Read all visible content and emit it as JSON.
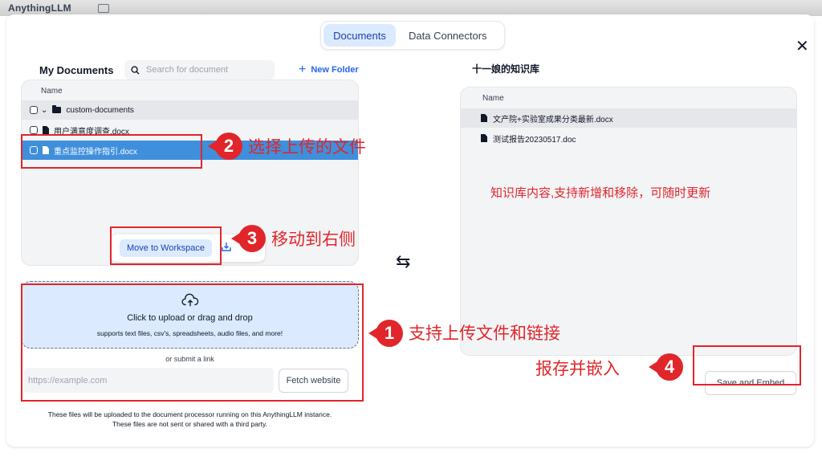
{
  "app": {
    "title": "AnythingLLM"
  },
  "tabs": [
    {
      "label": "Documents",
      "active": true
    },
    {
      "label": "Data Connectors",
      "active": false
    }
  ],
  "my_documents": {
    "title": "My Documents",
    "search_placeholder": "Search for document",
    "new_folder_label": "New Folder",
    "column_header": "Name",
    "items": [
      {
        "type": "folder",
        "name": "custom-documents",
        "selected": false
      },
      {
        "type": "file",
        "name": "用户满意度调查.docx",
        "selected": false
      },
      {
        "type": "file",
        "name": "重点监控操作指引.docx",
        "selected": true
      }
    ],
    "move_button_label": "Move to Workspace"
  },
  "workspace": {
    "title": "十一娘的知识库",
    "column_header": "Name",
    "items": [
      {
        "type": "file",
        "name": "文产院+实验室成果分类最新.docx"
      },
      {
        "type": "file",
        "name": "测试报告20230517.doc"
      }
    ],
    "save_button_label": "Save and Embed"
  },
  "upload": {
    "title": "Click to upload or drag and drop",
    "subtitle": "supports text files, csv's, spreadsheets, audio files, and more!",
    "or_link": "or submit a link",
    "link_placeholder": "https://example.com",
    "fetch_label": "Fetch website",
    "footnote_line1": "These files will be uploaded to the document processor running on this AnythingLLM instance.",
    "footnote_line2": "These files are not sent or shared with a third party."
  },
  "annotations": {
    "step1": {
      "number": "1",
      "text": "支持上传文件和链接"
    },
    "step2": {
      "number": "2",
      "text": "选择上传的文件"
    },
    "step3": {
      "number": "3",
      "text": "移动到右侧"
    },
    "step4": {
      "number": "4",
      "text": "报存并嵌入"
    },
    "kb_note": "知识库内容,支持新增和移除，可随时更新",
    "color": "#e0262b"
  },
  "colors": {
    "accent": "#2563eb",
    "selected_row": "#3f8fdc",
    "active_tab_bg": "#dbeafe"
  }
}
